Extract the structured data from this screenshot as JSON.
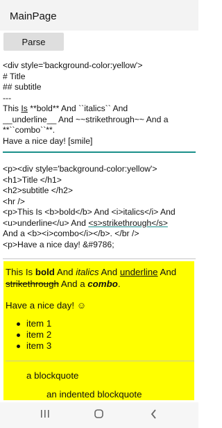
{
  "app": {
    "title": "MainPage"
  },
  "toolbar": {
    "parse_label": "Parse"
  },
  "markdown_editor": {
    "lines": [
      "<div style='background-color:yellow'>",
      "# Title",
      "## subtitle",
      "---",
      "This Is **bold** And ``italics`` And",
      "__underline__ And ~~strikethrough~~ And a",
      "**``combo``**.",
      "Have a nice day! [smile]"
    ],
    "word_this": "This ",
    "word_is": "Is",
    "line5_rest": " **bold** And ``italics`` And"
  },
  "html_editor": {
    "lines": [
      "<p><div style='background-color:yellow'>",
      "<h1>Title </h1>",
      "<h2>subtitle   </h2>",
      "<hr />",
      "<p>This Is <b>bold</b> And <i>italics</i> And",
      "<u>underline</u> And ",
      "<s>strikethrough</s>",
      "And a <b><i>combo</i></b>.  </br />",
      "<p>Have a nice day! &#9786;"
    ]
  },
  "preview": {
    "p1_a": "This Is ",
    "p1_bold": "bold",
    "p1_b": " And ",
    "p1_italic": "italics",
    "p1_c": " And ",
    "p1_underline": "underline",
    "p1_d": " And",
    "p1_strike": "strikethrough",
    "p1_e": " And a ",
    "p1_combo": "combo",
    "p1_f": ".",
    "p2": "Have a nice day! ☺",
    "items": [
      "item 1",
      "item 2",
      "item 3"
    ],
    "blockquote": "a blockquote",
    "indented_blockquote": "an indented blockquote"
  },
  "colors": {
    "preview_bg": "#ffff00",
    "accent": "#1a8f8a"
  }
}
